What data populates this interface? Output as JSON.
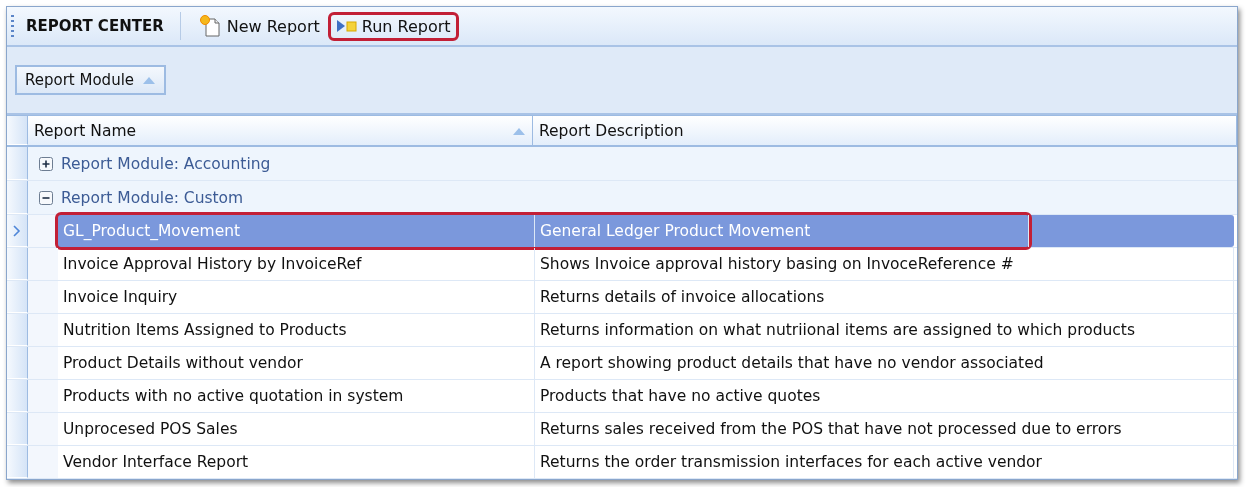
{
  "toolbar": {
    "title": "REPORT CENTER",
    "buttons": [
      {
        "label": "New Report",
        "kind": "new",
        "outlined": false
      },
      {
        "label": "Run Report",
        "kind": "run",
        "outlined": true
      }
    ]
  },
  "group_panel": {
    "chips": [
      {
        "label": "Report Module",
        "sorted": true
      }
    ]
  },
  "table": {
    "columns": [
      {
        "label": "Report Name",
        "sorted": true
      },
      {
        "label": "Report Description",
        "sorted": false
      }
    ],
    "groups": [
      {
        "label": "Report Module: Accounting",
        "expanded": false
      },
      {
        "label": "Report Module: Custom",
        "expanded": true,
        "rows": [
          {
            "name": "GL_Product_Movement",
            "description": "General Ledger Product Movement",
            "selected": true,
            "outlined": true
          },
          {
            "name": "Invoice Approval History by InvoiceRef",
            "description": "Shows Invoice approval history basing on InvoceReference #",
            "selected": false,
            "outlined": false
          },
          {
            "name": "Invoice Inquiry",
            "description": "Returns details of invoice allocations",
            "selected": false,
            "outlined": false
          },
          {
            "name": "Nutrition Items Assigned to Products",
            "description": "Returns information on what nutriional items are assigned to which products",
            "selected": false,
            "outlined": false
          },
          {
            "name": "Product Details without vendor",
            "description": "A report showing product details that have no vendor associated",
            "selected": false,
            "outlined": false
          },
          {
            "name": "Products with no active quotation in system",
            "description": "Products that have no active quotes",
            "selected": false,
            "outlined": false
          },
          {
            "name": "Unprocesed POS Sales",
            "description": "Returns sales received from the POS that have not processed due to errors",
            "selected": false,
            "outlined": false
          },
          {
            "name": "Vendor Interface Report",
            "description": "Returns the order transmission interfaces for each active vendor",
            "selected": false,
            "outlined": false
          }
        ]
      }
    ]
  }
}
